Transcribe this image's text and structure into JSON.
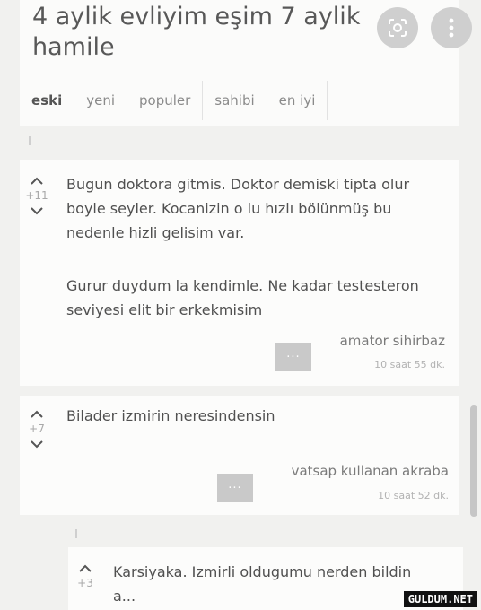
{
  "header": {
    "title": "4 aylik evliyim eşim 7 aylik hamile",
    "tabs": [
      "eski",
      "yeni",
      "populer",
      "sahibi",
      "en iyi"
    ]
  },
  "comments": [
    {
      "score": "+11",
      "paragraphs": [
        "Bugun doktora gitmis. Doktor demiski tipta olur boyle seyler. Kocanizin o lu hızlı bölünmüş bu nedenle hizli gelisim var.",
        "Gurur duydum la kendimle. Ne kadar testesteron seviyesi elit bir erkekmisim"
      ],
      "author": "amator sihirbaz",
      "time": "10 saat 55 dk."
    },
    {
      "score": "+7",
      "paragraphs": [
        "Bilader izmirin neresindensin"
      ],
      "author": "vatsap kullanan akraba",
      "time": "10 saat 52 dk."
    },
    {
      "score": "+3",
      "paragraphs": [
        "Karsiyaka. Izmirli oldugumu nerden bildin a..."
      ],
      "author": "",
      "time": ""
    }
  ],
  "avatar_glyph": "···",
  "watermark": "GULDUM.NET",
  "colors": {
    "background": "#f1f1ef",
    "card": "#fcfcfb",
    "avatar": "#c9c9c9",
    "button": "#cfcfcf"
  }
}
